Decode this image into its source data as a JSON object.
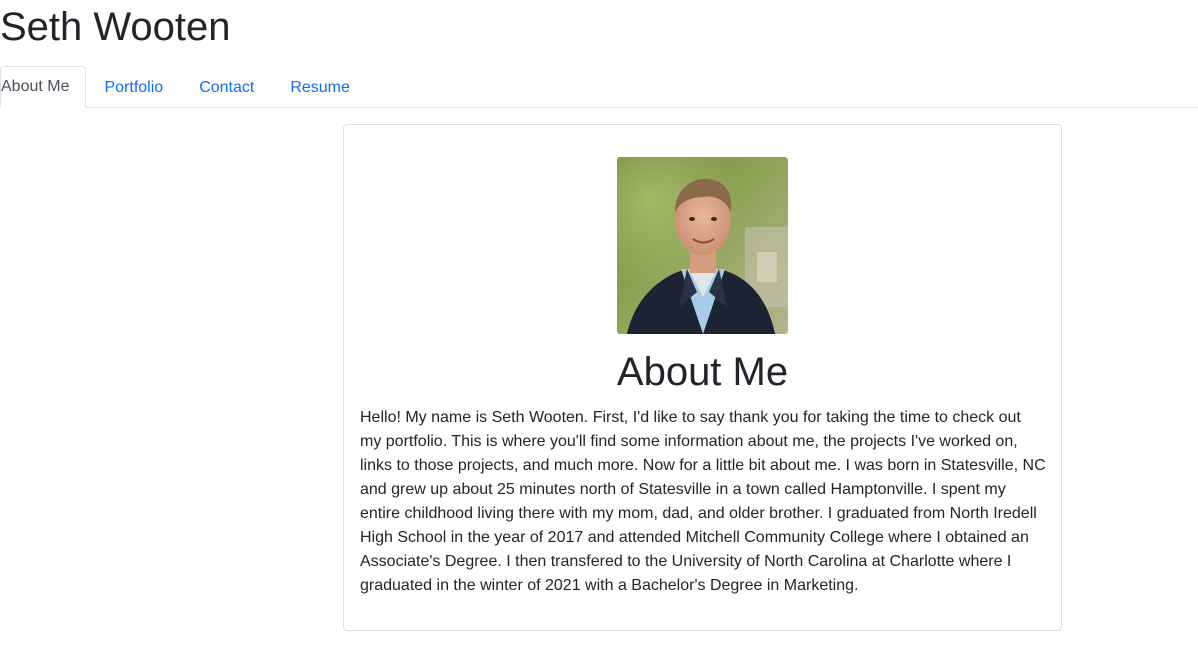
{
  "header": {
    "title": "Seth Wooten"
  },
  "nav": {
    "tabs": [
      {
        "label": "About Me",
        "active": true
      },
      {
        "label": "Portfolio",
        "active": false
      },
      {
        "label": "Contact",
        "active": false
      },
      {
        "label": "Resume",
        "active": false
      }
    ]
  },
  "about": {
    "photo_alt": "Seth Wooten",
    "heading": "About Me",
    "bio": "Hello! My name is Seth Wooten. First, I'd like to say thank you for taking the time to check out my portfolio. This is where you'll find some information about me, the projects I've worked on, links to those projects, and much more. Now for a little bit about me. I was born in Statesville, NC and grew up about 25 minutes north of Statesville in a town called Hamptonville. I spent my entire childhood living there with my mom, dad, and older brother. I graduated from North Iredell High School in the year of 2017 and attended Mitchell Community College where I obtained an Associate's Degree. I then transfered to the University of North Carolina at Charlotte where I graduated in the winter of 2021 with a Bachelor's Degree in Marketing."
  },
  "colors": {
    "link": "#0d6efd",
    "active_tab_text": "#495057",
    "border": "#dee2e6",
    "text": "#212529"
  }
}
